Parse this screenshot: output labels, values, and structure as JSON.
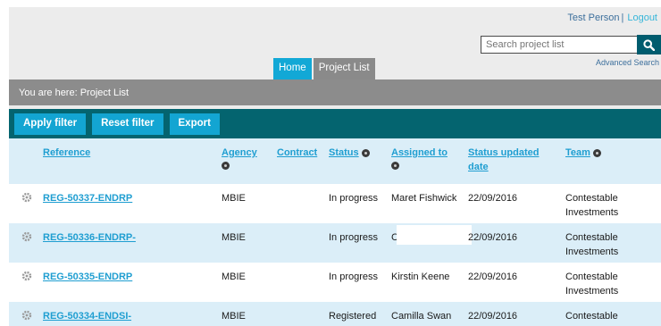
{
  "header": {
    "user_name": "Test Person",
    "separator": "|",
    "logout_label": "Logout",
    "search_placeholder": "Search project list",
    "advanced_search_label": "Advanced Search"
  },
  "nav": {
    "tabs": [
      {
        "label": "Home",
        "active": false
      },
      {
        "label": "Project List",
        "active": true
      }
    ]
  },
  "breadcrumb": {
    "text": "You are here: Project List"
  },
  "toolbar": {
    "apply_filter": "Apply filter",
    "reset_filter": "Reset filter",
    "export": "Export"
  },
  "table": {
    "columns": {
      "reference": "Reference",
      "agency": "Agency",
      "contract": "Contract",
      "status": "Status",
      "assigned_to": "Assigned to",
      "status_updated_date": "Status updated date",
      "team": "Team"
    },
    "rows": [
      {
        "reference": "REG-50337-ENDRP",
        "agency": "MBIE",
        "contract": "",
        "status": "In progress",
        "assigned_to": "Maret Fishwick",
        "date": "22/09/2016",
        "team": "Contestable Investments"
      },
      {
        "reference": "REG-50336-ENDRP-",
        "agency": "MBIE",
        "contract": "",
        "status": "In progress",
        "assigned_to": "C",
        "date": "22/09/2016",
        "team": "Contestable Investments"
      },
      {
        "reference": "REG-50335-ENDRP",
        "agency": "MBIE",
        "contract": "",
        "status": "In progress",
        "assigned_to": "Kirstin Keene",
        "date": "22/09/2016",
        "team": "Contestable Investments"
      },
      {
        "reference": "REG-50334-ENDSI-",
        "agency": "MBIE",
        "contract": "",
        "status": "Registered",
        "assigned_to": "Camilla Swan",
        "date": "22/09/2016",
        "team": "Contestable Investments"
      }
    ]
  },
  "colors": {
    "accent": "#13a5d2",
    "toolbar_bg": "#04646f",
    "breadcrumb_bg": "#8c8c8c",
    "row_alt_bg": "#dbeef8",
    "link": "#1f9ed1"
  },
  "icons": {
    "search": "search-icon",
    "gear": "gear-icon",
    "info": "info-icon"
  }
}
